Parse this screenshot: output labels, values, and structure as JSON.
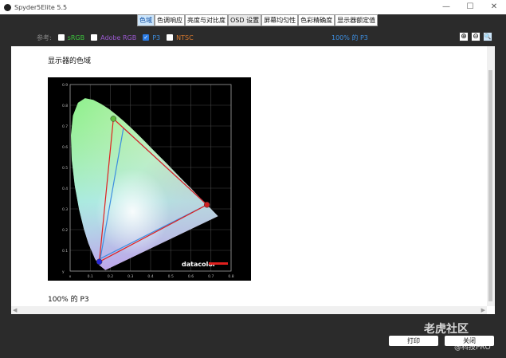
{
  "window": {
    "title": "Spyder5Elite 5.5",
    "minimize": "—",
    "maximize": "☐",
    "close": "✕"
  },
  "tabs": [
    {
      "label": "色域",
      "active": true
    },
    {
      "label": "色调响应"
    },
    {
      "label": "亮度与对比度"
    },
    {
      "label": "OSD 设置"
    },
    {
      "label": "屏幕均匀性"
    },
    {
      "label": "色彩精确度"
    },
    {
      "label": "显示器额定值"
    }
  ],
  "toolbar": {
    "reference_label": "参考:",
    "options": [
      {
        "label": "sRGB",
        "checked": false,
        "color": "#3cc43c"
      },
      {
        "label": "Adobe RGB",
        "checked": false,
        "color": "#9b59d0"
      },
      {
        "label": "P3",
        "checked": true,
        "color": "#3d8ee0"
      },
      {
        "label": "NTSC",
        "checked": false,
        "color": "#d9782d"
      }
    ],
    "coverage": "100% 的 P3",
    "zoom_in": "⊕",
    "zoom_out": "⊖",
    "zoom_fit": "🔍"
  },
  "report": {
    "heading": "显示器的色域",
    "caption": "100% 的 P3",
    "logo": "datacolor"
  },
  "chart_data": {
    "type": "scatter",
    "title": "",
    "xlabel": "",
    "ylabel": "",
    "xlim": [
      0,
      0.8
    ],
    "ylim": [
      0,
      0.9
    ],
    "grid": true,
    "x_ticks": [
      "x",
      "0.1",
      "0.2",
      "0.3",
      "0.4",
      "0.5",
      "0.6",
      "0.7",
      "0.8"
    ],
    "y_ticks": [
      "y",
      "0.1",
      "0.2",
      "0.3",
      "0.4",
      "0.5",
      "0.6",
      "0.7",
      "0.8",
      "0.9"
    ],
    "series": [
      {
        "points": [
          [
            0.68,
            0.32
          ],
          [
            0.215,
            0.735
          ],
          [
            0.145,
            0.045
          ]
        ],
        "color": "#e0201e"
      },
      {
        "points": [
          [
            0.68,
            0.32
          ],
          [
            0.265,
            0.69
          ],
          [
            0.15,
            0.06
          ]
        ],
        "color": "#3d8ee0"
      }
    ]
  },
  "buttons": {
    "print": "打印",
    "close": "关闭"
  },
  "watermark": {
    "text": "老虎社区",
    "sub": "@科技PRO"
  }
}
